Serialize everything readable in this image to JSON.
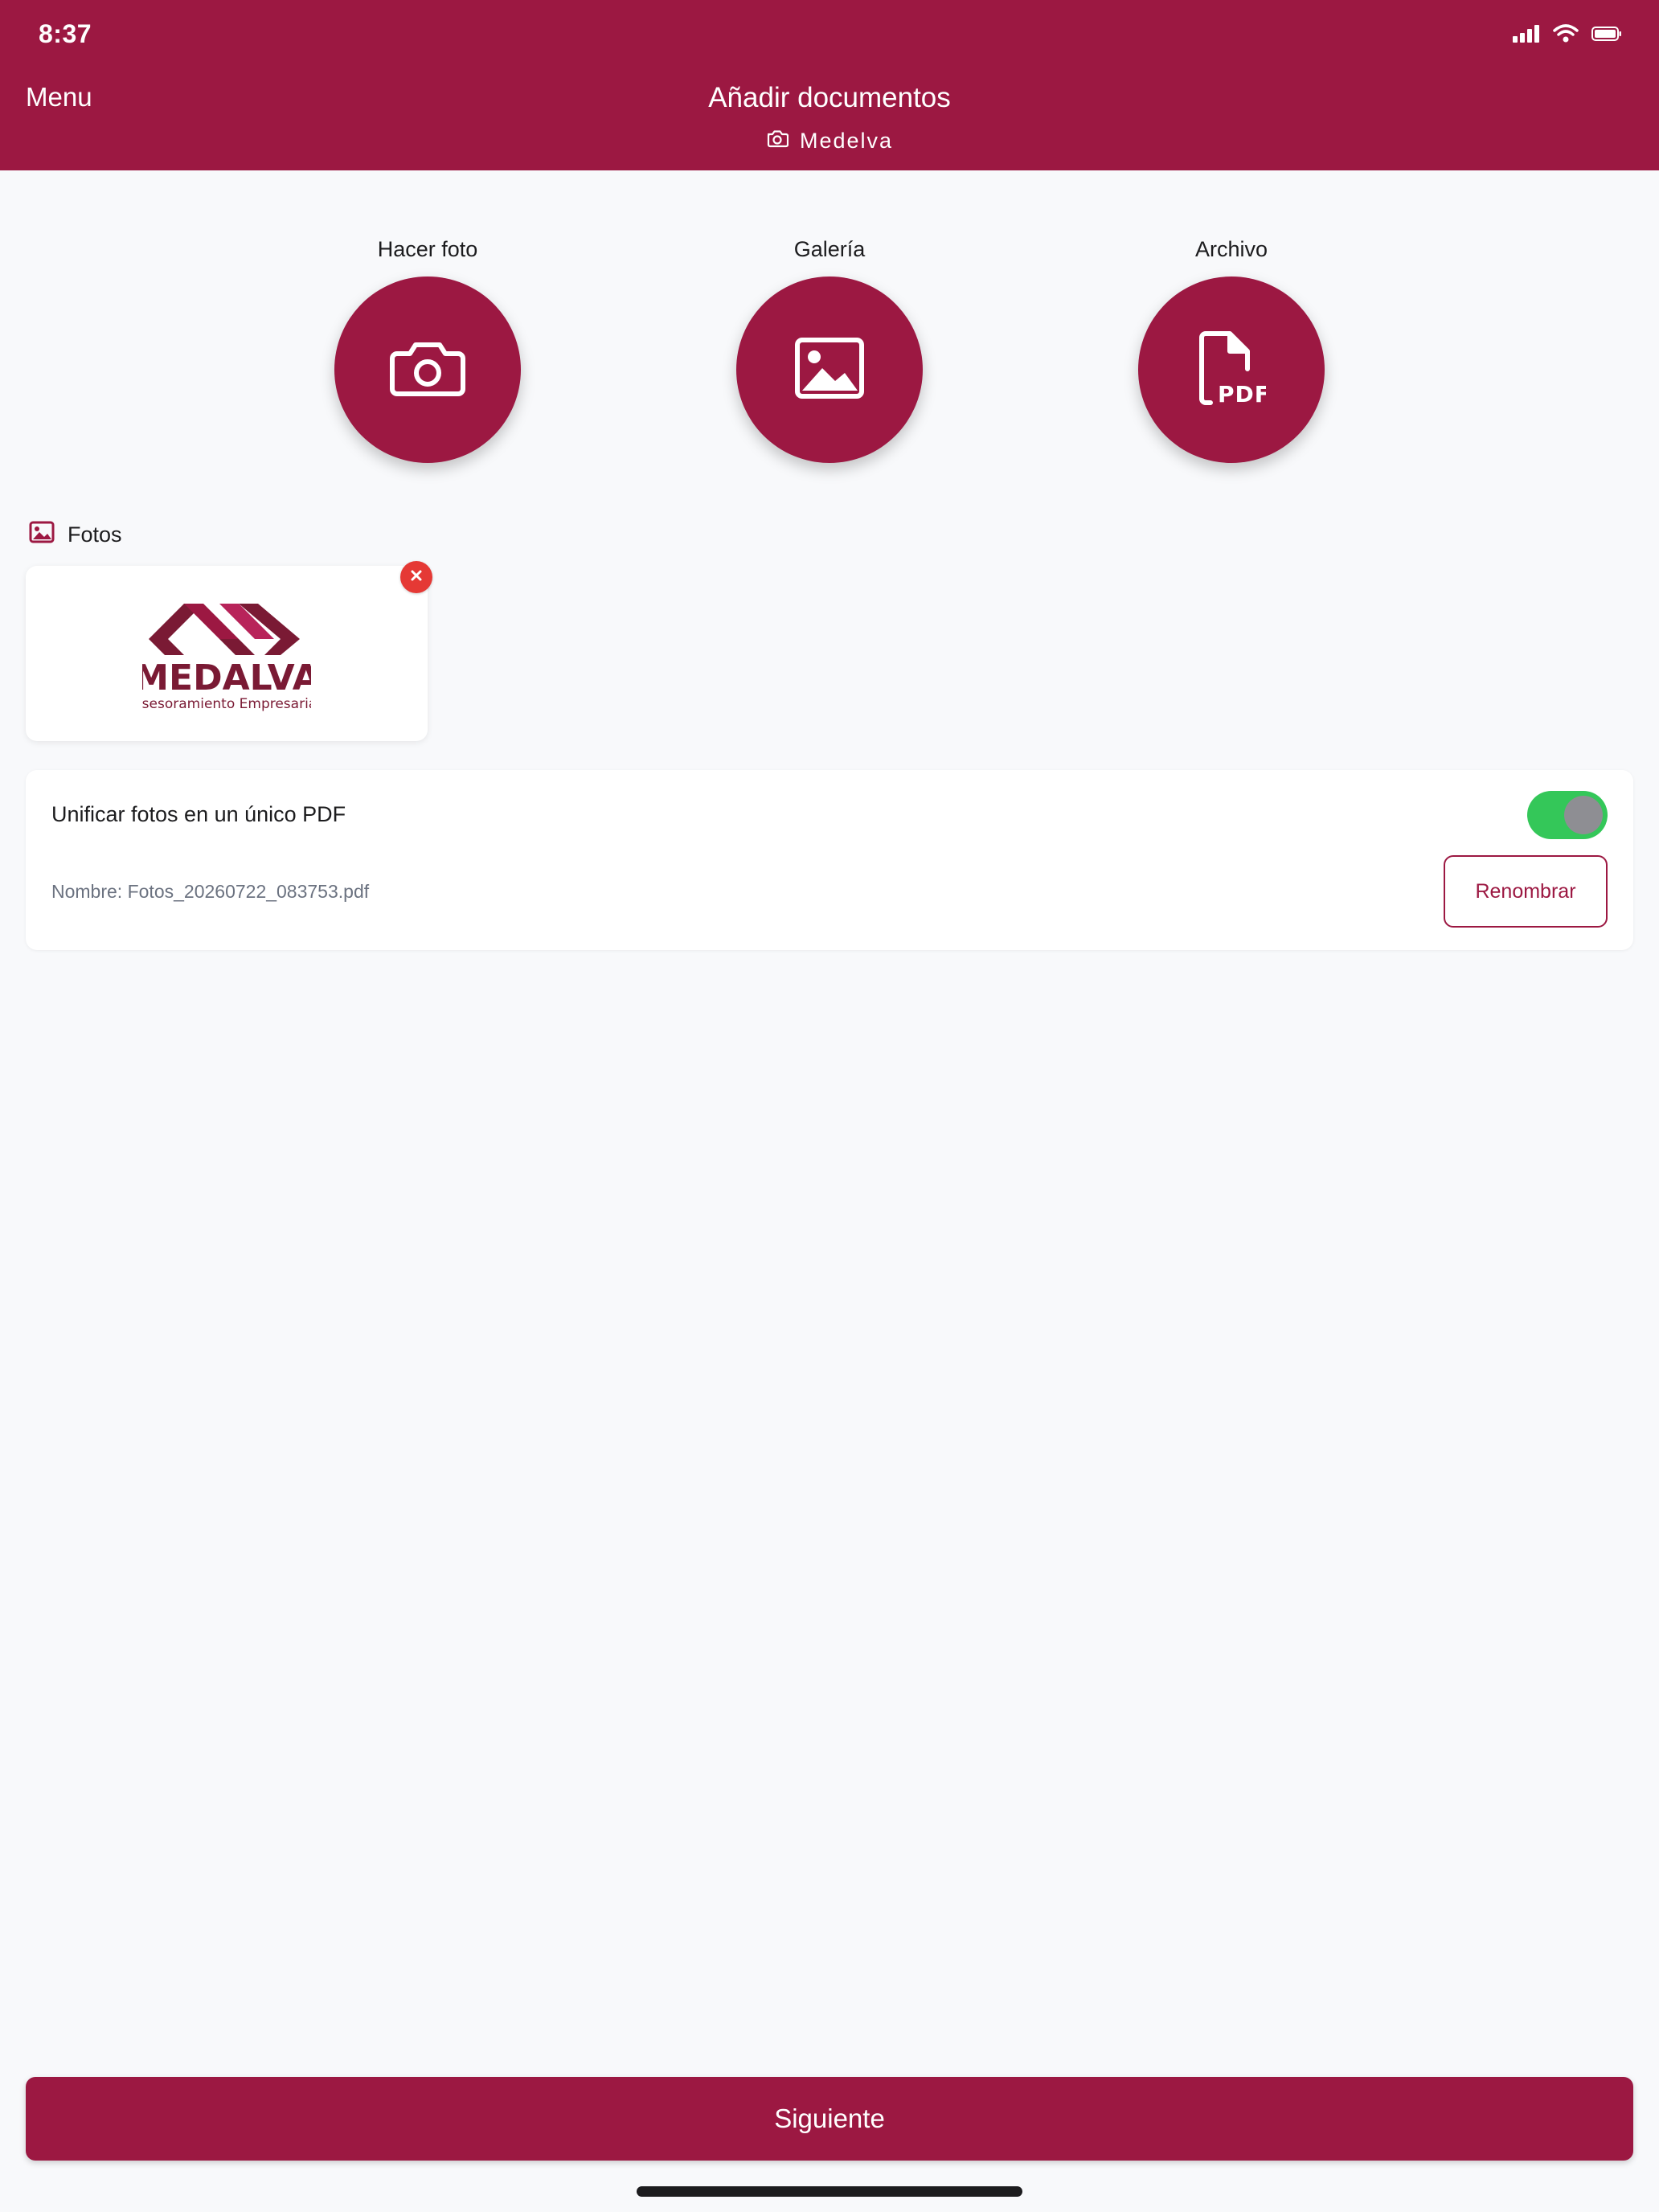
{
  "status_bar": {
    "time": "8:37"
  },
  "header": {
    "menu_label": "Menu",
    "title": "Añadir documentos",
    "subtitle": "Medelva",
    "background_color": "#9c1842"
  },
  "actions": [
    {
      "label": "Hacer foto",
      "icon": "camera-icon"
    },
    {
      "label": "Galería",
      "icon": "image-icon"
    },
    {
      "label": "Archivo",
      "icon": "pdf-file-icon",
      "icon_text": "PDF"
    }
  ],
  "photos_section": {
    "label": "Fotos",
    "items": [
      {
        "logo_name": "MEDALVA",
        "logo_tagline": "Asesoramiento Empresarial"
      }
    ]
  },
  "unify_card": {
    "title": "Unificar fotos en un único PDF",
    "toggle_on": true,
    "file_name": "Nombre: Fotos_20260722_083753.pdf",
    "rename_label": "Renombrar"
  },
  "footer": {
    "next_label": "Siguiente"
  },
  "colors": {
    "accent": "#9c1842",
    "toggle_on": "#34c759",
    "remove": "#e53935"
  }
}
